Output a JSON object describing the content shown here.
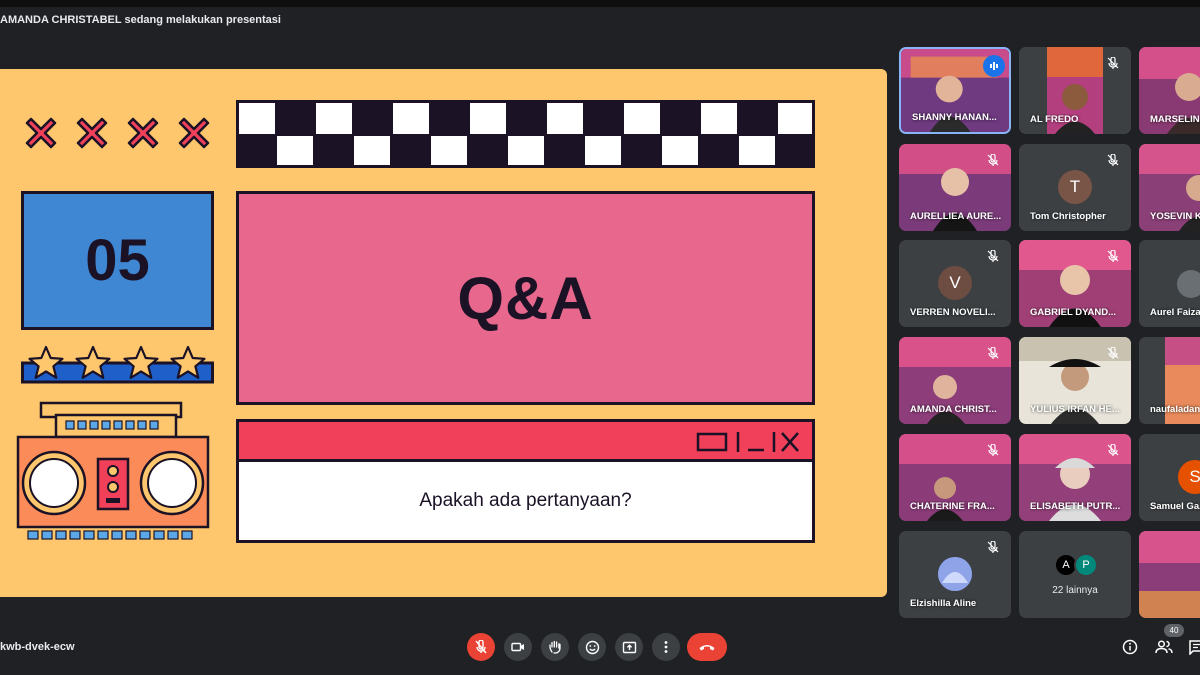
{
  "header": {
    "presenting_text": "AMANDA CHRISTABEL sedang melakukan presentasi"
  },
  "slide": {
    "number": "05",
    "title": "Q&A",
    "question": "Apakah ada pertanyaan?",
    "colors": {
      "background": "#fec76d",
      "blue": "#3f86d3",
      "pink": "#e8678c",
      "red": "#f0405a",
      "dark": "#1b1226"
    },
    "decor_icons": [
      "x-mark-icon",
      "star-icon",
      "boombox-icon",
      "window-controls-icon"
    ]
  },
  "participants": [
    {
      "name": "SHANNY HANAN...",
      "speaking": true,
      "video": true
    },
    {
      "name": "AL FREDO",
      "muted": true,
      "video": true
    },
    {
      "name": "MARSELIN...",
      "video": true
    },
    {
      "name": "AURELLIEA AURE...",
      "muted": true,
      "video": true
    },
    {
      "name": "Tom Christopher",
      "muted": true,
      "initial": "T",
      "avatar_color": "#795548"
    },
    {
      "name": "YOSEVIN K...",
      "video": true
    },
    {
      "name": "VERREN NOVELI...",
      "muted": true,
      "initial": "V",
      "avatar_color": "#6d4c41"
    },
    {
      "name": "GABRIEL DYAND...",
      "muted": true,
      "video": true
    },
    {
      "name": "Aurel Faiza...",
      "video": false
    },
    {
      "name": "AMANDA CHRIST...",
      "muted": true,
      "video": true
    },
    {
      "name": "YULIUS IRFAN HE...",
      "muted": true,
      "video": true
    },
    {
      "name": "naufaladan...",
      "video": true
    },
    {
      "name": "CHATERINE FRA...",
      "muted": true,
      "video": true
    },
    {
      "name": "ELISABETH PUTR...",
      "muted": true,
      "video": true
    },
    {
      "name": "Samuel Ga...",
      "initial": "S",
      "avatar_color": "#e65100"
    },
    {
      "name": "Elzishilla Aline",
      "muted": true,
      "video": false
    }
  ],
  "more_participants": {
    "label": "22 lainnya",
    "initials": [
      "A",
      "P"
    ],
    "colors": [
      "#000000",
      "#00897b"
    ]
  },
  "footer": {
    "meeting_code": "kwb-dvek-ecw",
    "controls": [
      "microphone-off-icon",
      "camera-icon",
      "raise-hand-icon",
      "emoji-icon",
      "present-screen-icon",
      "more-options-icon",
      "end-call-icon"
    ],
    "participant_count": "40"
  }
}
